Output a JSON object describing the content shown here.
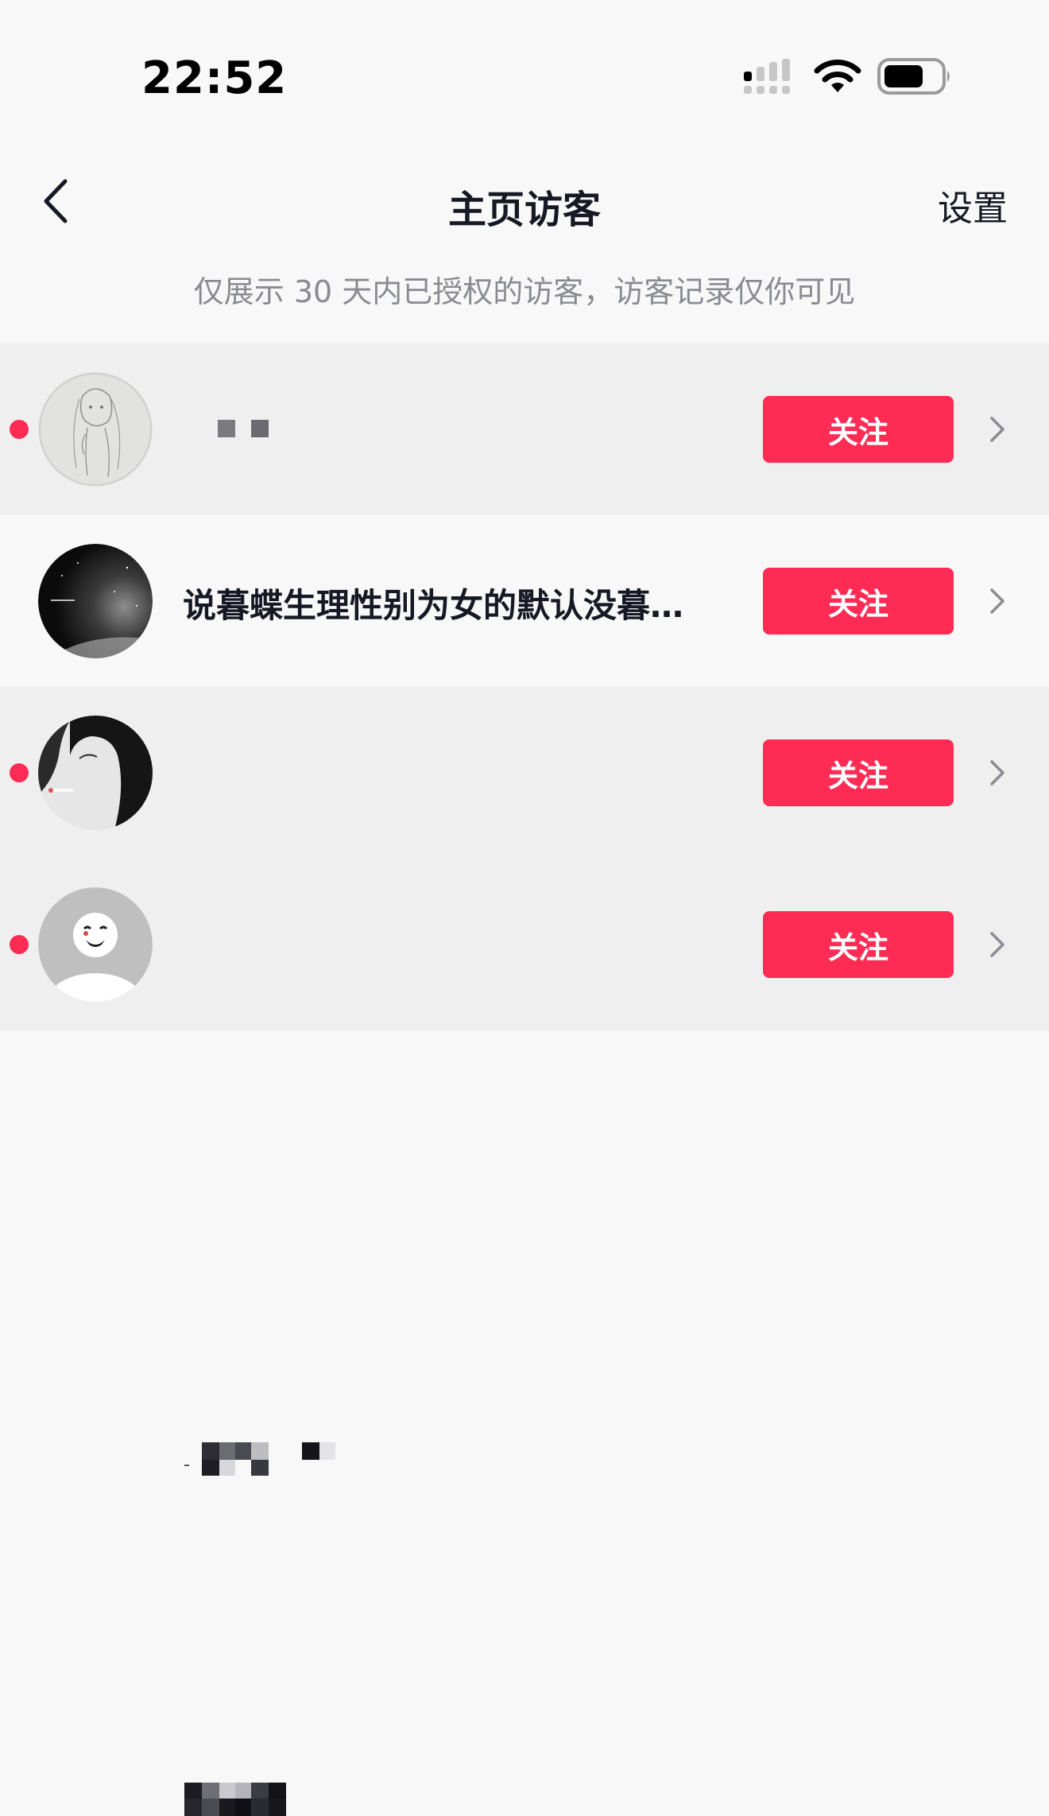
{
  "status_bar": {
    "time": "22:52",
    "icons": [
      "cellular-signal-icon",
      "wifi-icon",
      "battery-icon"
    ]
  },
  "header": {
    "back_icon": "chevron-left-icon",
    "title": "主页访客",
    "settings_label": "设置"
  },
  "notice": "仅展示 30 天内已授权的访客，访客记录仅你可见",
  "colors": {
    "accent": "#fe2c55",
    "text_primary": "#161823",
    "text_secondary": "#8a8b91",
    "row_shade": "#efefef",
    "background": "#f8f8f8"
  },
  "visitors": [
    {
      "nickname": "",
      "nickname_obscured": true,
      "unread": true,
      "follow_label": "关注",
      "avatar": "sketch-girl-avatar"
    },
    {
      "nickname": "说暮蝶生理性别为女的默认没暮…",
      "nickname_obscured": false,
      "unread": false,
      "follow_label": "关注",
      "avatar": "starry-sky-avatar"
    },
    {
      "nickname": "",
      "nickname_obscured": true,
      "unread": true,
      "follow_label": "关注",
      "avatar": "anime-silhouette-avatar"
    },
    {
      "nickname": "",
      "nickname_obscured": true,
      "unread": true,
      "follow_label": "关注",
      "avatar": "meme-face-avatar"
    }
  ]
}
